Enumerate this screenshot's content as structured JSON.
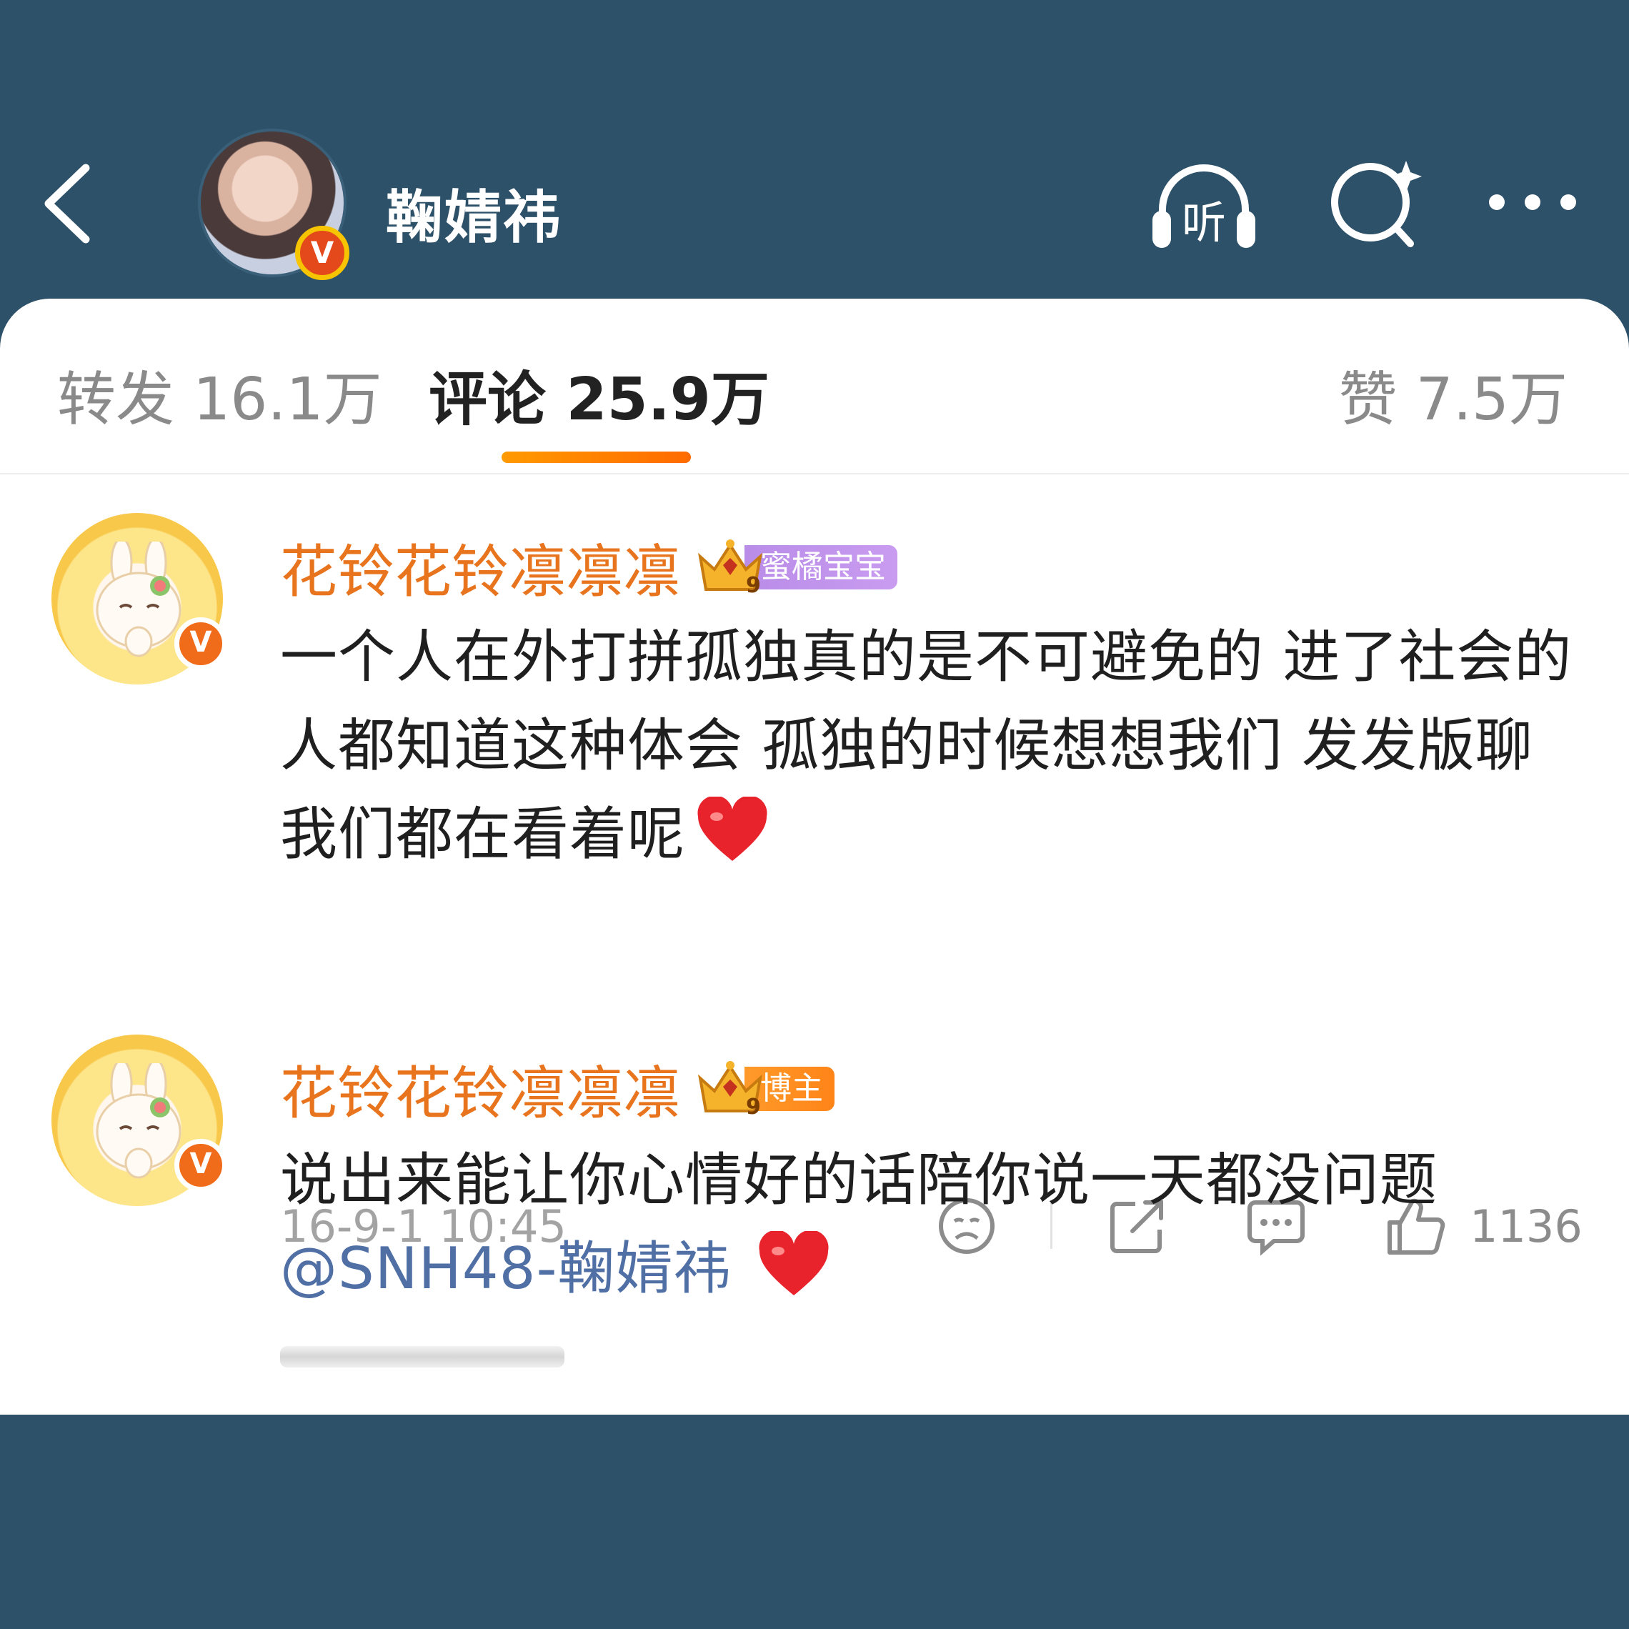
{
  "header": {
    "user_name": "鞠婧祎",
    "listen_label": "听",
    "icons": [
      "back-arrow-icon",
      "listen-headphones-icon",
      "search-sparkle-icon",
      "more-dots-icon"
    ],
    "colors": {
      "background": "#2d5169",
      "verified_badge": "#e3491b"
    }
  },
  "tabs": [
    {
      "label": "转发 16.1万",
      "active": false
    },
    {
      "label": "评论 25.9万",
      "active": true
    },
    {
      "label": "赞 7.5万",
      "active": false
    }
  ],
  "comments": [
    {
      "user": "花铃花铃凛凛凛",
      "badge_label": "蜜橘宝宝",
      "badge_level": "9",
      "text": "一个人在外打拼孤独真的是不可避免的 进了社会的人都知道这种体会 孤独的时候想想我们 发发版聊 我们都在看着呢",
      "timestamp": "16-9-1 10:45",
      "like_count": "1136"
    },
    {
      "user": "花铃花铃凛凛凛",
      "badge_label": "博主",
      "badge_level": "9",
      "text": "说出来能让你心情好的话陪你说一天都没问题",
      "mention": "@SNH48-鞠婧祎",
      "timestamp": "",
      "like_count": ""
    }
  ],
  "verified_mark": "V",
  "colors": {
    "name": "#e8741e",
    "mention": "#4f6fa5",
    "tab_indicator": "#ff8a00"
  }
}
